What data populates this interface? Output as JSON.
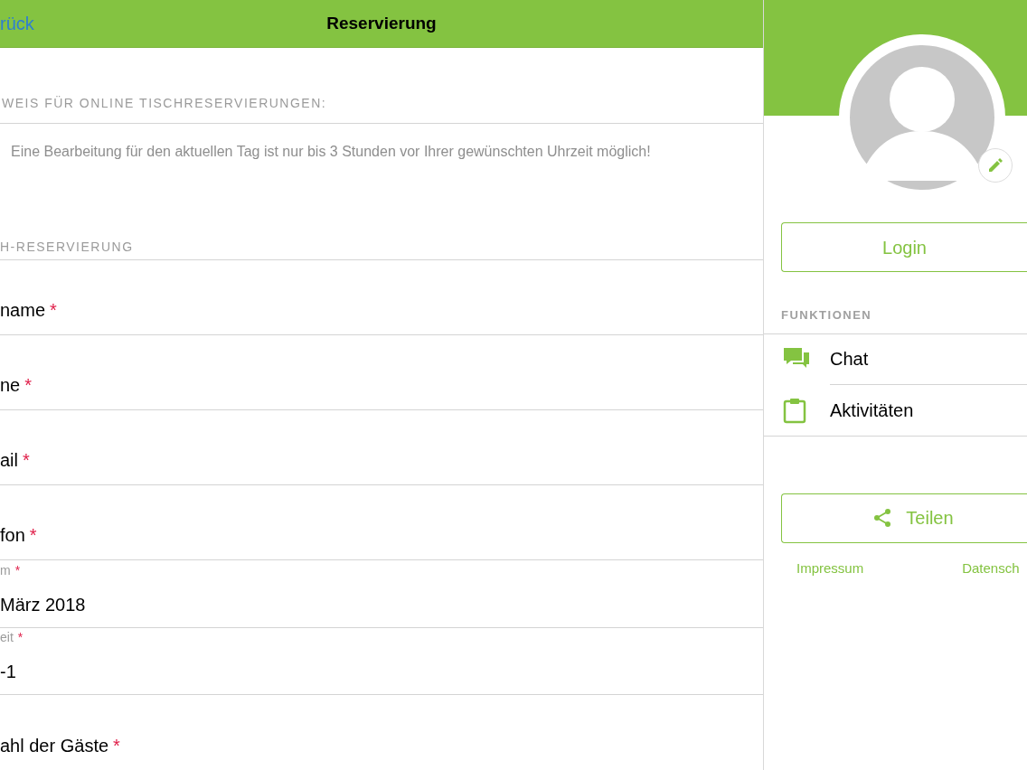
{
  "nav": {
    "back": "rück",
    "title": "Reservierung"
  },
  "notice": {
    "heading": "WEIS FÜR ONLINE TISCHRESERVIERUNGEN:",
    "text": "Eine Bearbeitung für den aktuellen Tag ist nur bis 3 Stunden vor Ihrer gewünschten Uhrzeit möglich!"
  },
  "form": {
    "heading": "H-RESERVIERUNG",
    "fields": [
      {
        "kind": "plain",
        "label": "name",
        "mark": "*"
      },
      {
        "kind": "plain",
        "label": "ne",
        "mark": "*"
      },
      {
        "kind": "plain",
        "label": "ail",
        "mark": "*"
      },
      {
        "kind": "plain",
        "label": "fon",
        "mark": "*"
      },
      {
        "kind": "floating",
        "label": "m",
        "mark": "*",
        "value": "März 2018"
      },
      {
        "kind": "floating",
        "label": "eit",
        "mark": "*",
        "value": "-1"
      },
      {
        "kind": "plain",
        "label": "ahl der Gäste",
        "mark": "*"
      }
    ]
  },
  "sidebar": {
    "login": "Login",
    "section": "FUNKTIONEN",
    "items": [
      {
        "kind": "chat",
        "label": "Chat"
      },
      {
        "kind": "clipboard",
        "label": "Aktivitäten"
      }
    ],
    "share": "Teilen",
    "links": [
      "Impressum",
      "Datensch"
    ]
  }
}
